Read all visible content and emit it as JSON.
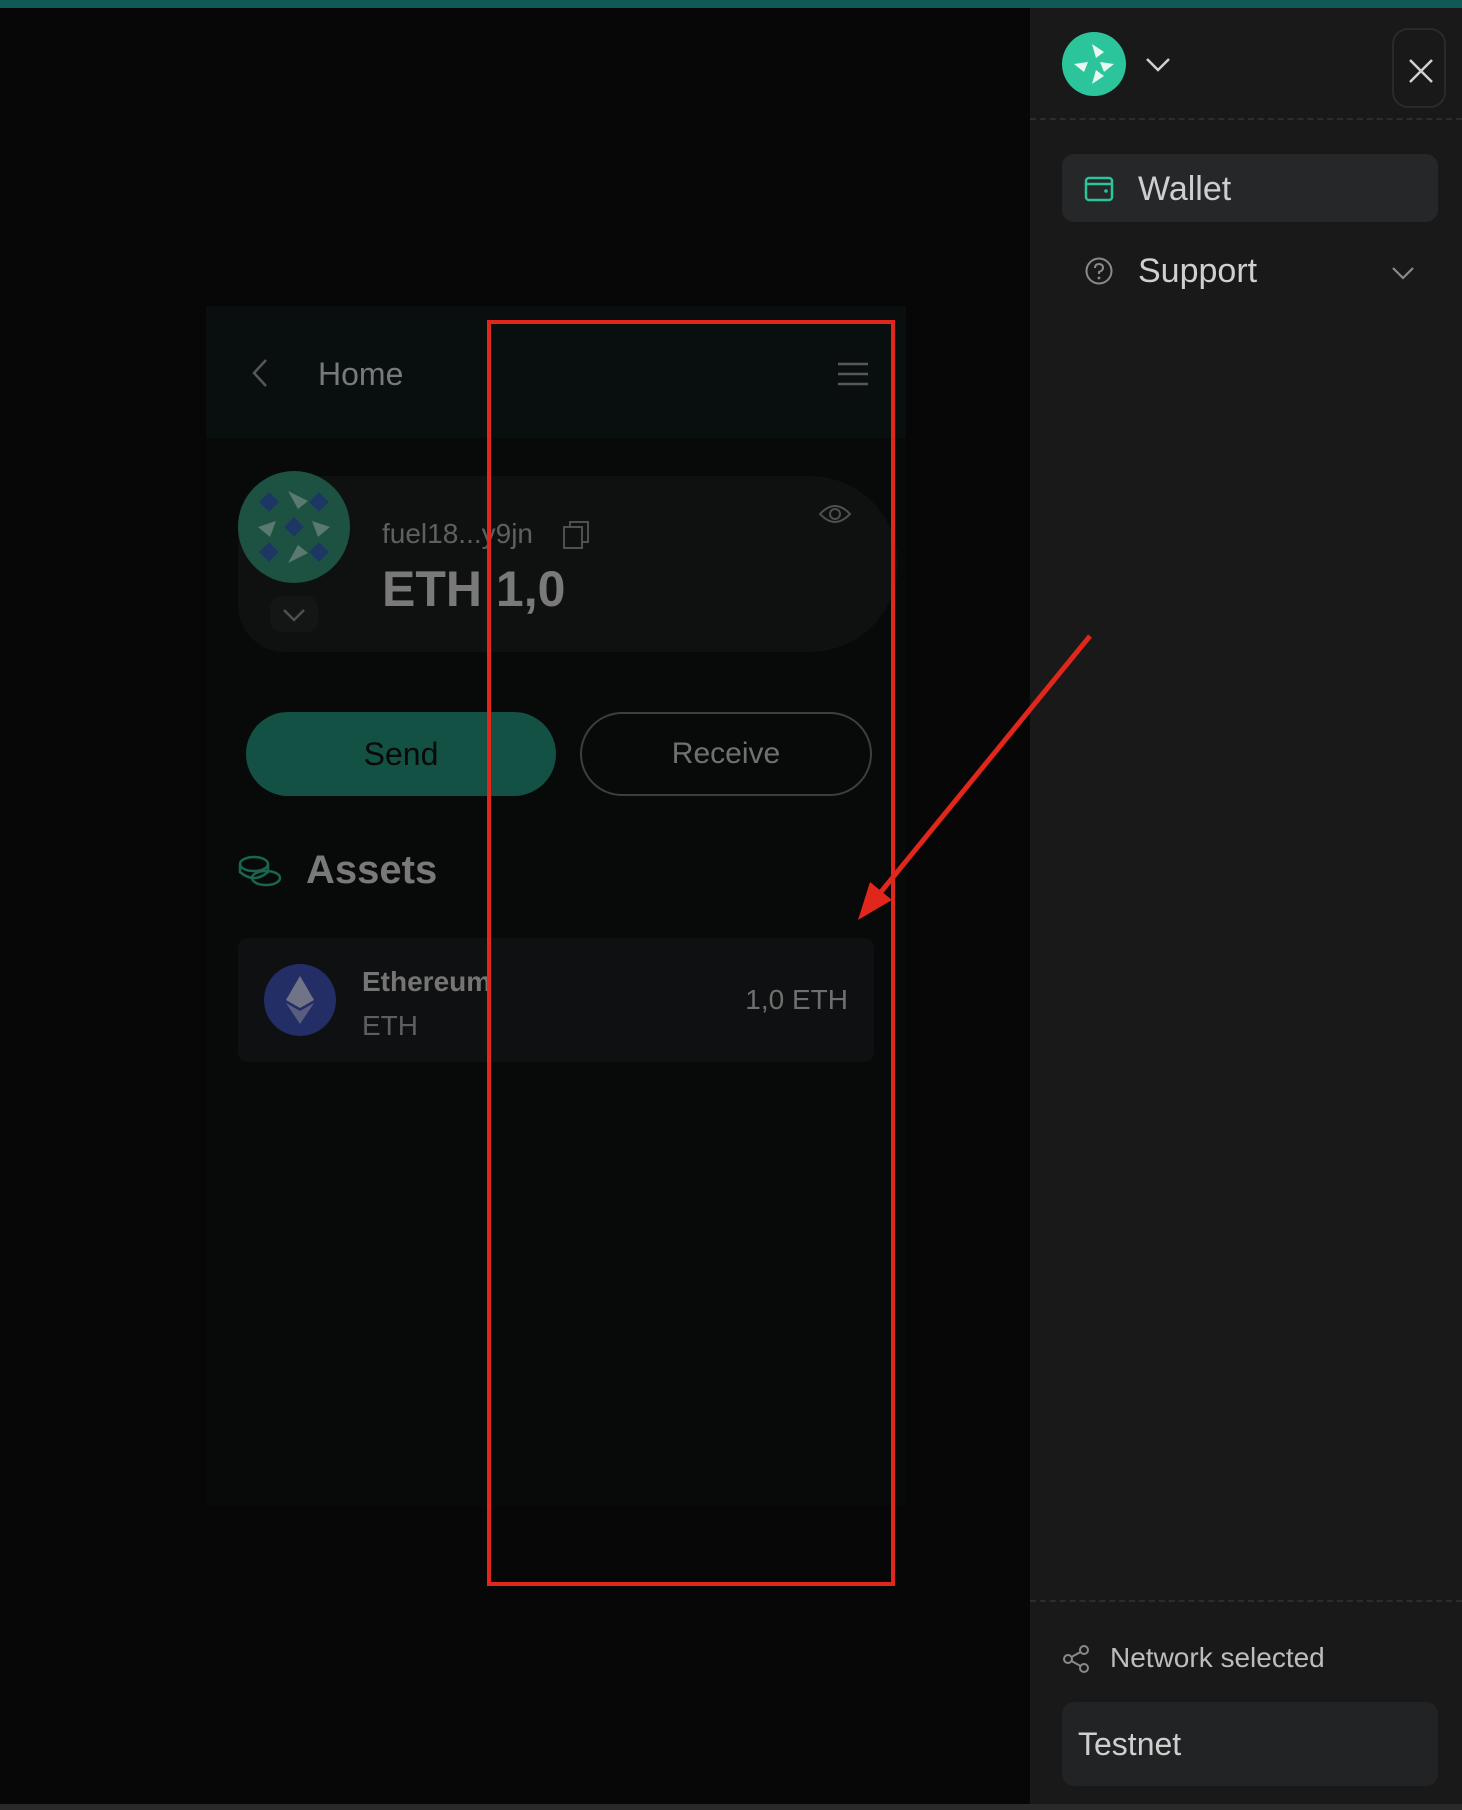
{
  "popup": {
    "title": "Home",
    "address": "fuel18...y9jn",
    "balance": "ETH 1,0",
    "send_label": "Send",
    "receive_label": "Receive",
    "assets_title": "Assets",
    "asset": {
      "name": "Ethereum",
      "symbol": "ETH",
      "amount": "1,0 ETH"
    }
  },
  "drawer": {
    "nav": [
      {
        "label": "Wallet",
        "icon": "wallet-icon"
      },
      {
        "label": "Support",
        "icon": "help-icon"
      }
    ],
    "network_label": "Network selected",
    "network_value": "Testnet"
  },
  "colors": {
    "accent": "#1c8f74",
    "drawer_bg": "#19191a",
    "annotation": "#e1261c"
  }
}
